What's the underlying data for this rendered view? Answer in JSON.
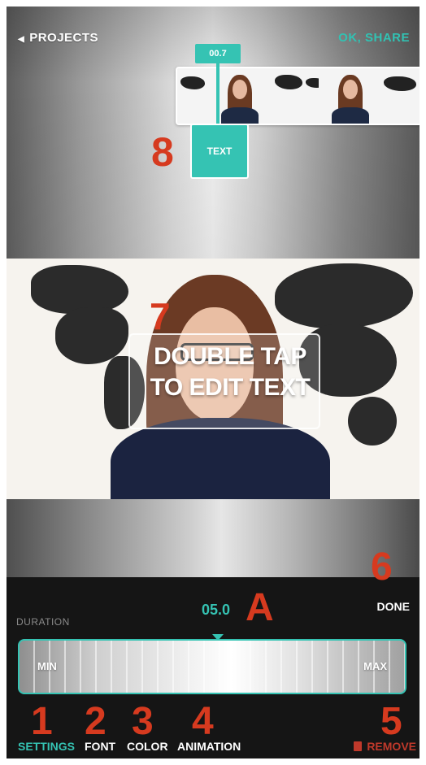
{
  "header": {
    "back_label": "PROJECTS",
    "share_label": "OK, SHARE"
  },
  "timeline": {
    "playhead_time": "00.7",
    "text_block_label": "TEXT"
  },
  "video": {
    "overlay_text_line1": "DOUBLE TAP",
    "overlay_text_line2": "TO EDIT TEXT"
  },
  "controls": {
    "duration_label": "DURATION",
    "duration_value": "05.0",
    "done_label": "DONE",
    "slider_min_label": "MIN",
    "slider_max_label": "MAX"
  },
  "tabs": [
    {
      "label": "SETTINGS",
      "active": true
    },
    {
      "label": "FONT",
      "active": false
    },
    {
      "label": "COLOR",
      "active": false
    },
    {
      "label": "ANIMATION",
      "active": false
    }
  ],
  "remove_label": "REMOVE",
  "callouts": {
    "c1": "1",
    "c2": "2",
    "c3": "3",
    "c4": "4",
    "c5": "5",
    "c6": "6",
    "c7": "7",
    "c8": "8",
    "cA": "A"
  },
  "colors": {
    "accent": "#35c3b3",
    "callout": "#d63a1f",
    "remove": "#c0392b",
    "panel": "#151515"
  }
}
